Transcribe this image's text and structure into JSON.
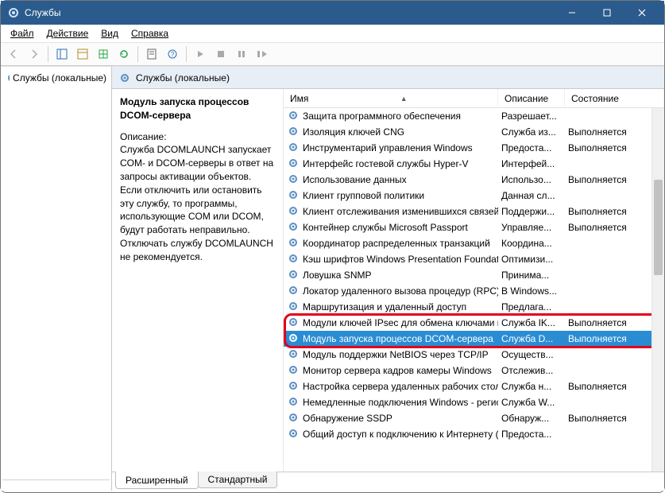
{
  "window": {
    "title": "Службы"
  },
  "menu": {
    "file": "Файл",
    "action": "Действие",
    "view": "Вид",
    "help": "Справка"
  },
  "tree": {
    "root": "Службы (локальные)"
  },
  "header": {
    "title": "Службы (локальные)"
  },
  "details": {
    "name": "Модуль запуска процессов DCOM-сервера",
    "desc_label": "Описание:",
    "desc": "Служба DCOMLAUNCH запускает COM- и DCOM-серверы в ответ на запросы активации объектов. Если отключить или остановить эту службу, то программы, использующие COM или DCOM, будут работать неправильно. Отключать службу DCOMLAUNCH не рекомендуется."
  },
  "columns": {
    "name": "Имя",
    "desc": "Описание",
    "state": "Состояние"
  },
  "services": [
    {
      "name": "Защита программного обеспечения",
      "desc": "Разрешает...",
      "state": ""
    },
    {
      "name": "Изоляция ключей CNG",
      "desc": "Служба из...",
      "state": "Выполняется"
    },
    {
      "name": "Инструментарий управления Windows",
      "desc": "Предоста...",
      "state": "Выполняется"
    },
    {
      "name": "Интерфейс гостевой службы Hyper-V",
      "desc": "Интерфей...",
      "state": ""
    },
    {
      "name": "Использование данных",
      "desc": "Использо...",
      "state": "Выполняется"
    },
    {
      "name": "Клиент групповой политики",
      "desc": "Данная сл...",
      "state": ""
    },
    {
      "name": "Клиент отслеживания изменившихся связей",
      "desc": "Поддержи...",
      "state": "Выполняется"
    },
    {
      "name": "Контейнер службы Microsoft Passport",
      "desc": "Управляе...",
      "state": "Выполняется"
    },
    {
      "name": "Координатор распределенных транзакций",
      "desc": "Координа...",
      "state": ""
    },
    {
      "name": "Кэш шрифтов Windows Presentation Foundatio...",
      "desc": "Оптимизи...",
      "state": ""
    },
    {
      "name": "Ловушка SNMP",
      "desc": "Принима...",
      "state": ""
    },
    {
      "name": "Локатор удаленного вызова процедур (RPC)",
      "desc": "В Windows...",
      "state": ""
    },
    {
      "name": "Маршрутизация и удаленный доступ",
      "desc": "Предлага...",
      "state": ""
    },
    {
      "name": "Модули ключей IPsec для обмена ключами в ...",
      "desc": "Служба IK...",
      "state": "Выполняется"
    },
    {
      "name": "Модуль запуска процессов DCOM-сервера",
      "desc": "Служба D...",
      "state": "Выполняется",
      "selected": true
    },
    {
      "name": "Модуль поддержки NetBIOS через TCP/IP",
      "desc": "Осуществ...",
      "state": ""
    },
    {
      "name": "Монитор сервера кадров камеры Windows",
      "desc": "Отслежив...",
      "state": ""
    },
    {
      "name": "Настройка сервера удаленных рабочих столов",
      "desc": "Служба н...",
      "state": "Выполняется"
    },
    {
      "name": "Немедленные подключения Windows - регист...",
      "desc": "Служба W...",
      "state": ""
    },
    {
      "name": "Обнаружение SSDP",
      "desc": "Обнаруж...",
      "state": "Выполняется"
    },
    {
      "name": "Общий доступ к подключению к Интернету (I...",
      "desc": "Предоста...",
      "state": ""
    }
  ],
  "tabs": {
    "extended": "Расширенный",
    "standard": "Стандартный"
  }
}
